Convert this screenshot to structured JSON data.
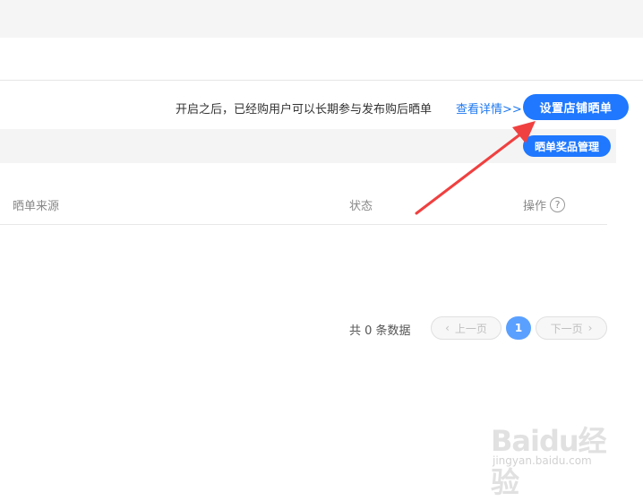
{
  "promo": {
    "text": "开启之后，已经购用户可以长期参与发布购后晒单",
    "link": "查看详情>>",
    "primary_button": "设置店铺晒单",
    "secondary_button": "晒单奖品管理"
  },
  "table": {
    "columns": [
      "晒单来源",
      "状态",
      "操作"
    ],
    "help_icon": "?"
  },
  "pagination": {
    "total": "共 0 条数据",
    "prev": "上一页",
    "current_page": "1",
    "next": "下一页"
  },
  "watermark": {
    "logo": "Baidu经验",
    "site": "jingyan.baidu.com"
  },
  "colors": {
    "accent": "#1f78ff",
    "arrow": "#f04040"
  }
}
